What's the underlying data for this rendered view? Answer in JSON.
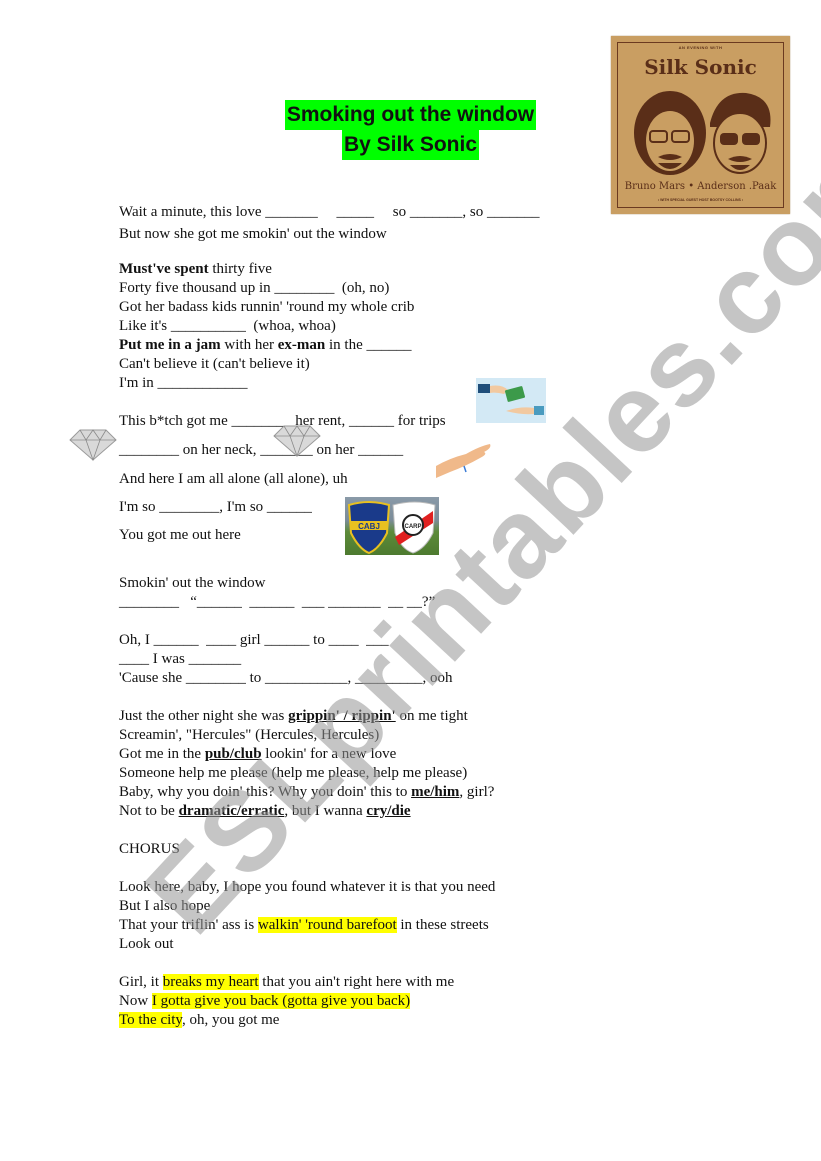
{
  "title": {
    "line1": "Smoking out the window",
    "line2": "By Silk Sonic",
    "highlight_color": "#00ff00"
  },
  "album_cover": {
    "top_text": "AN EVENING WITH",
    "title": "Silk Sonic",
    "names": "Bruno Mars • Anderson .Paak",
    "subtitle": "• WITH SPECIAL GUEST HOST BOOTSY COLLINS •",
    "bg_color": "#c99e62",
    "ink_color": "#5a2e18"
  },
  "lyrics": {
    "l1": "Wait a minute, this love _______     _____     so _______, so _______",
    "l2": "But now she got me smokin' out the window",
    "l3_bold": "Must've spent",
    "l3_rest": " thirty five",
    "l4": "Forty five thousand up in ________  (oh, no)",
    "l5": "Got her badass kids runnin' 'round my whole crib",
    "l6": "Like it's __________  (whoa, whoa)",
    "l7_bold1": "Put me in a jam",
    "l7_mid": " with her ",
    "l7_bold2": "ex-man",
    "l7_rest": " in the ______",
    "l8": "Can't believe it (can't believe it)",
    "l9": "I'm in ____________",
    "l10": "This b*tch got me ________ her rent, ______ for trips",
    "l11": "________ on her neck, _______ on her ______",
    "l12": "And here I am all alone (all alone), uh",
    "l13": "I'm so ________, I'm so ______",
    "l14": "You got me out here",
    "l15": "Smokin' out the window",
    "l16": "________   “______  ______  ___ _______  __ __?”",
    "l17": "Oh, I ______  ____ girl ______ to ____  ___",
    "l18": "____ I was _______",
    "l19": "'Cause she ________ to ___________, _________, ooh",
    "l20_a": "Just the other night she was ",
    "l20_b": "grippin' / rippin'",
    "l20_c": " on me tight",
    "l21": "Screamin', \"Hercules\" (Hercules, Hercules)",
    "l22_a": "Got me in the ",
    "l22_b": "pub/club",
    "l22_c": " lookin' for a new love",
    "l23": "Someone help me please (help me please, help me please)",
    "l24_a": "Baby, why you doin' this? Why you doin' this to ",
    "l24_b": "me/him",
    "l24_c": ", girl?",
    "l25_a": "Not to be ",
    "l25_b": "dramatic/erratic",
    "l25_c": ", but I wanna ",
    "l25_d": "cry/die",
    "l26": "CHORUS",
    "l27": "Look here, baby, I hope you found whatever it is that you need",
    "l28": "But I also hope",
    "l29_a": "That your triflin' ass is ",
    "l29_b": "walkin' 'round barefoot",
    "l29_c": " in these streets",
    "l30": "Look out",
    "l31_a": "Girl, it ",
    "l31_b": "breaks my heart",
    "l31_c": " that you ain't right here with me",
    "l32_a": "Now ",
    "l32_b": "I gotta give you back (gotta give you back)",
    "l33_a": "To the city",
    "l33_b": ", oh, you got me",
    "highlight_color": "#ffff00"
  },
  "images": {
    "money": "money-exchange-icon",
    "hand": "open-hand-icon",
    "diamond": "diamond-icon",
    "clubs": "boca-river-crests",
    "clubs_label_left": "CABJ",
    "clubs_label_right": "CARP"
  },
  "watermark": {
    "text": "ESLprintables.com"
  }
}
